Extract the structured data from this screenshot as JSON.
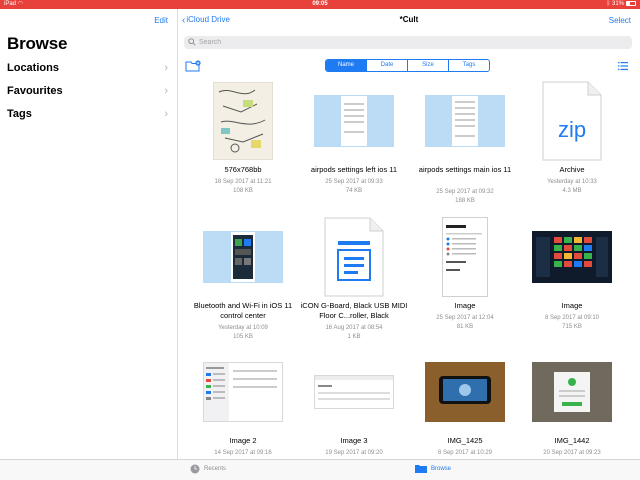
{
  "status": {
    "carrier": "iPad",
    "time": "09:05",
    "battery": "31%"
  },
  "sidebar": {
    "edit_label": "Edit",
    "title": "Browse",
    "sections": [
      {
        "label": "Locations"
      },
      {
        "label": "Favourites"
      },
      {
        "label": "Tags"
      }
    ]
  },
  "nav": {
    "back_label": "iCloud Drive",
    "title": "*Cult",
    "select_label": "Select"
  },
  "search": {
    "placeholder": "Search"
  },
  "sort": {
    "options": [
      "Name",
      "Date",
      "Size",
      "Tags"
    ],
    "selected": "Name"
  },
  "files": [
    {
      "name": "576x768bb",
      "date": "18 Sep 2017 at 11:21",
      "size": "108 KB"
    },
    {
      "name": "airpods settings left ios 11",
      "date": "25 Sep 2017 at 09:33",
      "size": "74 KB"
    },
    {
      "name": "airpods settings main ios 11",
      "date": "25 Sep 2017 at 09:32",
      "size": "188 KB"
    },
    {
      "name": "Archive",
      "date": "Yesterday at 10:33",
      "size": "4.3 MB"
    },
    {
      "name": "Bluetooth and Wi-Fi in iOS 11 control center",
      "date": "Yesterday at 10:09",
      "size": "105 KB"
    },
    {
      "name": "iCON G-Board, Black USB MIDI Floor C...roller, Black",
      "date": "16 Aug 2017 at 08:54",
      "size": "1 KB"
    },
    {
      "name": "Image",
      "date": "25 Sep 2017 at 12:04",
      "size": "81 KB"
    },
    {
      "name": "Image",
      "date": "8 Sep 2017 at 09:10",
      "size": "715 KB"
    },
    {
      "name": "Image 2",
      "date": "14 Sep 2017 at 09:16",
      "size": ""
    },
    {
      "name": "Image 3",
      "date": "19 Sep 2017 at 09:20",
      "size": ""
    },
    {
      "name": "IMG_1425",
      "date": "8 Sep 2017 at 10:29",
      "size": ""
    },
    {
      "name": "IMG_1442",
      "date": "20 Sep 2017 at 09:23",
      "size": ""
    }
  ],
  "zip_label": "zip",
  "tabbar": {
    "recents_label": "Recents",
    "browse_label": "Browse"
  },
  "colors": {
    "accent": "#1f7bf2",
    "status_bar": "#e8413b",
    "selected_thumb_bg": "#bcdcf6"
  }
}
